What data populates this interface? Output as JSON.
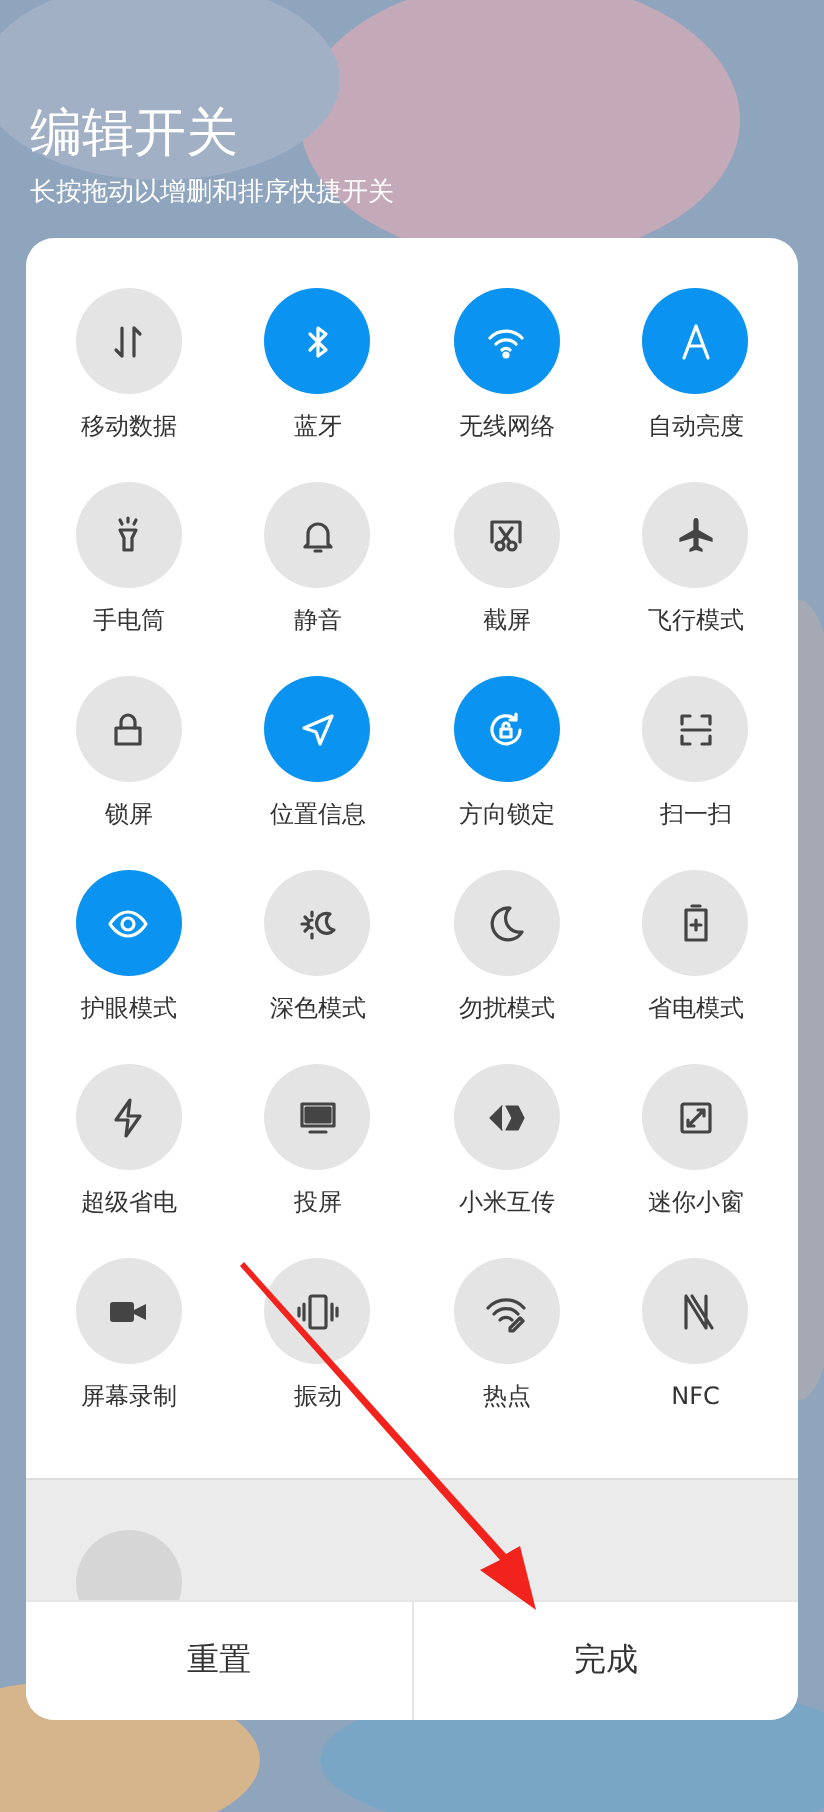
{
  "header": {
    "title": "编辑开关",
    "subtitle": "长按拖动以增删和排序快捷开关"
  },
  "tiles": [
    {
      "label": "移动数据",
      "on": false
    },
    {
      "label": "蓝牙",
      "on": true
    },
    {
      "label": "无线网络",
      "on": true
    },
    {
      "label": "自动亮度",
      "on": true
    },
    {
      "label": "手电筒",
      "on": false
    },
    {
      "label": "静音",
      "on": false
    },
    {
      "label": "截屏",
      "on": false
    },
    {
      "label": "飞行模式",
      "on": false
    },
    {
      "label": "锁屏",
      "on": false
    },
    {
      "label": "位置信息",
      "on": true
    },
    {
      "label": "方向锁定",
      "on": true
    },
    {
      "label": "扫一扫",
      "on": false
    },
    {
      "label": "护眼模式",
      "on": true
    },
    {
      "label": "深色模式",
      "on": false
    },
    {
      "label": "勿扰模式",
      "on": false
    },
    {
      "label": "省电模式",
      "on": false
    },
    {
      "label": "超级省电",
      "on": false
    },
    {
      "label": "投屏",
      "on": false
    },
    {
      "label": "小米互传",
      "on": false
    },
    {
      "label": "迷你小窗",
      "on": false
    },
    {
      "label": "屏幕录制",
      "on": false
    },
    {
      "label": "振动",
      "on": false
    },
    {
      "label": "热点",
      "on": false
    },
    {
      "label": "NFC",
      "on": false
    }
  ],
  "buttons": [
    "重置",
    "完成"
  ]
}
